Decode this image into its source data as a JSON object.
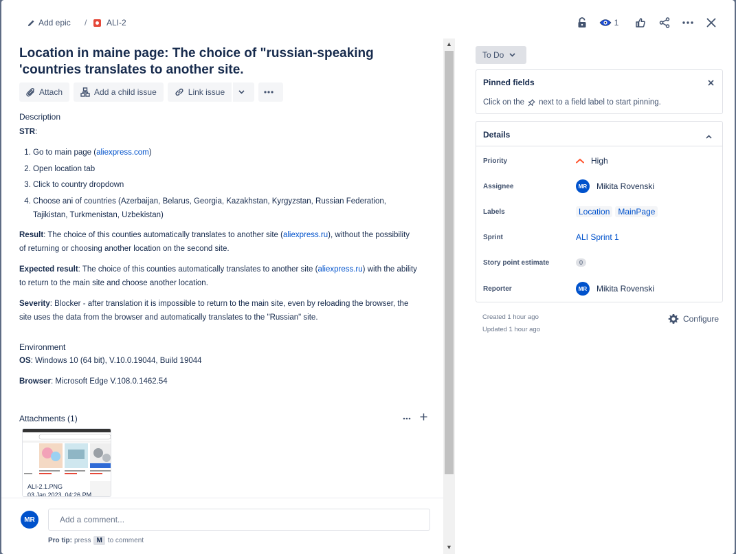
{
  "breadcrumb": {
    "epic_label": "Add epic",
    "separator": "/",
    "issue_key": "ALI-2"
  },
  "top_actions": {
    "watch_count": "1"
  },
  "issue": {
    "title": "Location in maine page: The choice of \"russian-speaking 'countries translates to another site.",
    "actions": {
      "attach": "Attach",
      "child": "Add a child issue",
      "link": "Link issue"
    },
    "description_label": "Description",
    "str_label": "STR",
    "str_colon": ":",
    "steps": [
      {
        "text": "Go to main page (",
        "link": "aliexpress.com",
        "after": ")"
      },
      {
        "text": "Open location tab",
        "link": "",
        "after": ""
      },
      {
        "text": "Click to country dropdown",
        "link": "",
        "after": ""
      },
      {
        "text": "Choose ani of countries (Azerbaijan, Belarus, Georgia, Kazakhstan, Kyrgyzstan, Russian Federation, Tajikistan, Turkmenistan, Uzbekistan)",
        "link": "",
        "after": ""
      }
    ],
    "result": {
      "label": "Result",
      "pre": ": The choice of this counties automatically translates to another site (",
      "link": "aliexpress.ru",
      "post": "), without the possibility of returning or choosing another location on the second site."
    },
    "expected": {
      "label": "Expected result",
      "pre": ": The choice of this counties automatically translates to another site (",
      "link": "aliexpress.ru",
      "post": ") with the ability to return to the main site and choose another location."
    },
    "severity": {
      "label": "Severity",
      "text": ": Blocker - after translation it is impossible to return to the main site, even by reloading the browser, the site uses the data from the browser and automatically translates to the \"Russian\" site."
    },
    "environment_label": "Environment",
    "os": {
      "label": "OS",
      "text": ": Windows 10 (64 bit), V.10.0.19044, Build 19044"
    },
    "browser": {
      "label": "Browser",
      "text": ": Microsoft Edge V.108.0.1462.54"
    },
    "attachments_label": "Attachments (1)",
    "attachment": {
      "name": "ALI-2.1.PNG",
      "date": "03 Jan 2023, 04:26 PM"
    }
  },
  "comment": {
    "avatar": "MR",
    "placeholder": "Add a comment...",
    "protip_label": "Pro tip:",
    "protip_pre": "press",
    "protip_key": "M",
    "protip_post": "to comment"
  },
  "sidebar": {
    "status": "To Do",
    "pinned": {
      "title": "Pinned fields",
      "pre": "Click on the",
      "post": "next to a field label to start pinning."
    },
    "details": {
      "title": "Details",
      "priority": {
        "label": "Priority",
        "value": "High"
      },
      "assignee": {
        "label": "Assignee",
        "avatar": "MR",
        "value": "Mikita Rovenski"
      },
      "labels": {
        "label": "Labels",
        "values": [
          "Location",
          "MainPage"
        ]
      },
      "sprint": {
        "label": "Sprint",
        "value": "ALI Sprint 1"
      },
      "story_points": {
        "label": "Story point estimate",
        "value": "0"
      },
      "reporter": {
        "label": "Reporter",
        "avatar": "MR",
        "value": "Mikita Rovenski"
      }
    },
    "created": "Created 1 hour ago",
    "updated": "Updated 1 hour ago",
    "configure": "Configure"
  },
  "colors": {
    "accent": "#0052cc",
    "bug": "#e5493a",
    "priority_high": "#ff5630"
  },
  "icons": [
    "pencil-icon",
    "bug-icon",
    "lock-icon",
    "eye-icon",
    "thumbs-up-icon",
    "share-icon",
    "more-icon",
    "close-icon",
    "paperclip-icon",
    "child-issue-icon",
    "link-icon",
    "chevron-down-icon",
    "pin-icon",
    "chevron-up-icon",
    "priority-high-icon",
    "gear-icon",
    "plus-icon"
  ]
}
